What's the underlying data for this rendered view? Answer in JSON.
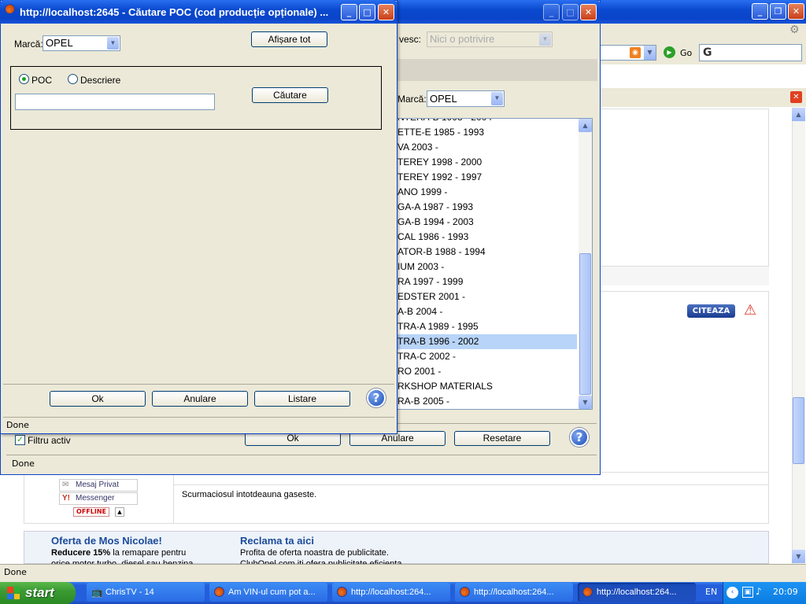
{
  "browser": {
    "go_label": "Go",
    "status": "Done",
    "sidebar": {
      "mesaj_privat": "Mesaj Privat",
      "messenger": "Messenger",
      "offline": "OFFLINE"
    },
    "post_text": "Scurmaciosul intotdeauna gaseste.",
    "citeaza": "CITEAZA",
    "promo": {
      "title_left": "Oferta de Mos Nicolae!",
      "text_left_bold": "Reducere 15%",
      "text_left_rest": " la remapare pentru",
      "text_left_2": "orice motor turbo, diesel sau benzina",
      "title_right": "Reclama ta aici",
      "text_right": "Profita de oferta noastra de publicitate.",
      "text_right_2": "ClubOpel.com iti ofera publicitate eficienta"
    }
  },
  "back_dialog": {
    "label_mesaj_partial": "vesc:",
    "nici_value": "Nici o potrivire",
    "marca_label": "Marcă:",
    "marca_value": "OPEL",
    "list_items": [
      "ETTE-E 1985 - 1993",
      "VA 2003 -",
      "TEREY 1998 - 2000",
      "TEREY 1992 - 1997",
      "ANO 1999 -",
      "GA-A 1987 - 1993",
      "GA-B 1994 - 2003",
      "CAL 1986 - 1993",
      "ATOR-B 1988 - 1994",
      "IUM 2003 -",
      "RA 1997 - 1999",
      "EDSTER 2001 -",
      "A-B 2004 -",
      "TRA-A 1989 - 1995",
      "TRA-B 1996 - 2002",
      "TRA-C 2002 -",
      "RO 2001 -",
      "RKSHOP MATERIALS",
      "RA-B 2005 -"
    ],
    "selected_index": 14,
    "top_partial_item": "NTERA-B 1993 - 2004",
    "filtru": "Filtru activ",
    "ok": "Ok",
    "anulare": "Anulare",
    "resetare": "Resetare",
    "status": "Done"
  },
  "dialog": {
    "title": "http://localhost:2645 - Căutare POC (cod producție opționale) ...",
    "marca_label": "Marcă:",
    "marca_value": "OPEL",
    "afisare_tot": "Afișare tot",
    "radio_poc": "POC",
    "radio_descriere": "Descriere",
    "cautare": "Căutare",
    "search_value": "",
    "ok": "Ok",
    "anulare": "Anulare",
    "listare": "Listare",
    "status": "Done"
  },
  "taskbar": {
    "start": "start",
    "items": [
      {
        "label": "ChrisTV - 14"
      },
      {
        "label": "Am VIN-ul cum pot a..."
      },
      {
        "label": "http://localhost:264..."
      },
      {
        "label": "http://localhost:264..."
      },
      {
        "label": "http://localhost:264..."
      }
    ],
    "lang": "EN",
    "clock": "20:09"
  },
  "colors": {
    "xp_blue": "#0a44c8",
    "dialog_bg": "#ece9d8",
    "selection": "#b8d4f8",
    "taskbar": "#245edb",
    "start_green": "#3c9a34"
  }
}
